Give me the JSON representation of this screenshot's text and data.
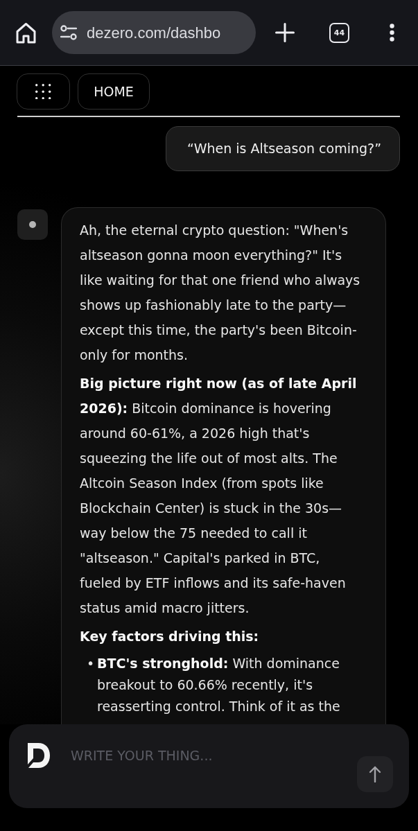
{
  "browser": {
    "url": "dezero.com/dashbo",
    "tab_count": "44"
  },
  "nav": {
    "home_label": "HOME"
  },
  "messages": [
    {
      "kind": "user",
      "text": "“When is Altseason coming?”"
    },
    {
      "kind": "assistant",
      "blocks": [
        {
          "kind": "paragraph",
          "text": "Ah, the eternal crypto question: \"When's altseason gonna moon everything?\" It's like waiting for that one friend who always shows up fashionably late to the party—except this time, the party's been Bitcoin-only for months."
        },
        {
          "kind": "paragraph",
          "text": "**Big picture right now (as of late April 2026):** Bitcoin dominance is hovering around 60-61%, a 2026 high that's squeezing the life out of most alts. The Altcoin Season Index (from spots like Blockchain Center) is stuck in the 30s—way below the 75 needed to call it \"altseason.\" Capital's parked in BTC, fueled by ETF inflows and its safe-haven status amid macro jitters."
        },
        {
          "kind": "heading",
          "text": "Key factors driving this:"
        },
        {
          "kind": "bullets",
          "items": [
            {
              "marker": "•",
              "text": "**BTC's stronghold:** With dominance breakout to 60.66% recently, it's reasserting control. Think of it as the"
            }
          ]
        }
      ]
    }
  ],
  "composer": {
    "placeholder": "WRITE YOUR THING..."
  }
}
